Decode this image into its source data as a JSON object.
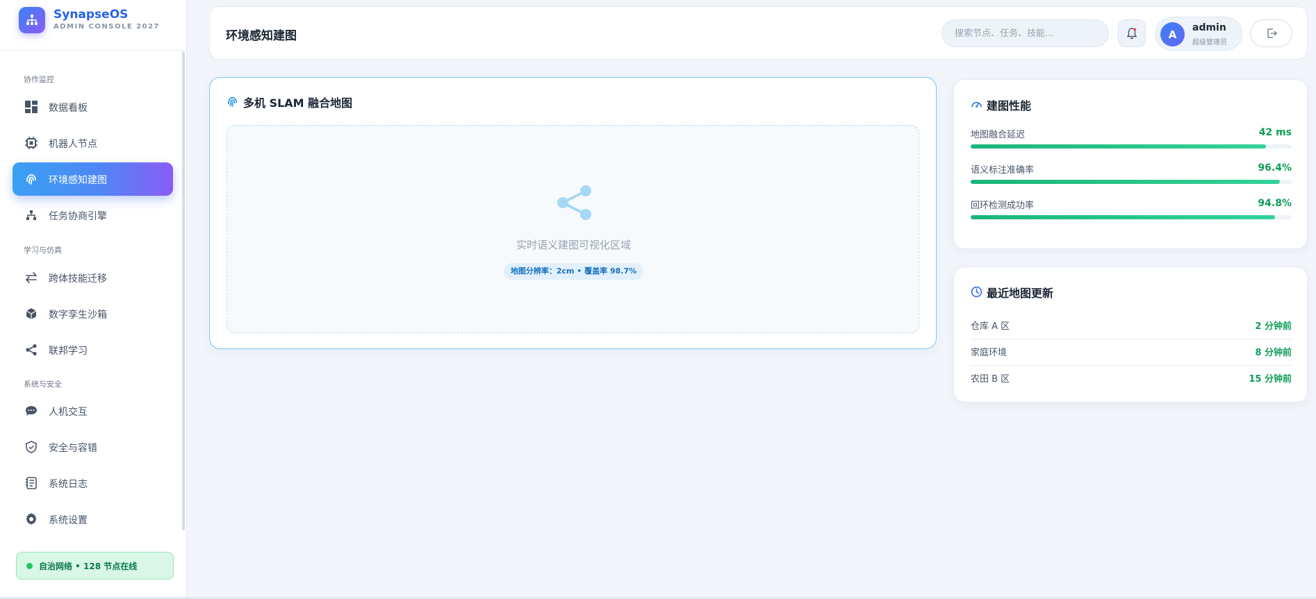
{
  "brand": {
    "name": "SynapseOS",
    "subtitle": "ADMIN CONSOLE 2027"
  },
  "sidebar": {
    "sections": [
      {
        "label": "协作监控"
      },
      {
        "label": "学习与仿真"
      },
      {
        "label": "系统与安全"
      }
    ],
    "items": [
      {
        "label": "数据看板",
        "icon": "dashboard-icon"
      },
      {
        "label": "机器人节点",
        "icon": "chip-icon"
      },
      {
        "label": "环境感知建图",
        "icon": "fingerprint-icon",
        "active": true
      },
      {
        "label": "任务协商引擎",
        "icon": "sitemap-icon"
      },
      {
        "label": "跨体技能迁移",
        "icon": "swap-arrows-icon"
      },
      {
        "label": "数字孪生沙箱",
        "icon": "cube-icon"
      },
      {
        "label": "联邦学习",
        "icon": "share-nodes-icon"
      },
      {
        "label": "人机交互",
        "icon": "chat-bubble-icon"
      },
      {
        "label": "安全与容错",
        "icon": "shield-icon"
      },
      {
        "label": "系统日志",
        "icon": "log-book-icon"
      },
      {
        "label": "系统设置",
        "icon": "gear-icon"
      }
    ],
    "network_status": "自治网络 • 128 节点在线"
  },
  "header": {
    "title": "环境感知建图",
    "search_placeholder": "搜索节点、任务、技能...",
    "user": {
      "initial": "A",
      "name": "admin",
      "role": "超级管理员"
    }
  },
  "map_panel": {
    "title": "多机 SLAM 融合地图",
    "caption": "实时语义建图可视化区域",
    "chip": "地图分辨率：2cm • 覆盖率 98.7%"
  },
  "performance": {
    "title": "建图性能",
    "metrics": [
      {
        "label": "地图融合延迟",
        "value": "42 ms",
        "fill": 0.92
      },
      {
        "label": "语义标注准确率",
        "value": "96.4%",
        "fill": 0.964
      },
      {
        "label": "回环检测成功率",
        "value": "94.8%",
        "fill": 0.948
      }
    ]
  },
  "updates": {
    "title": "最近地图更新",
    "rows": [
      {
        "name": "仓库 A 区",
        "time": "2 分钟前"
      },
      {
        "name": "家庭环境",
        "time": "8 分钟前"
      },
      {
        "name": "农田 B 区",
        "time": "15 分钟前"
      }
    ]
  },
  "colors": {
    "accent": "#3b82f6",
    "accent_purple": "#8b5cf6",
    "success": "#0f9d58",
    "status_bg": "#d8f7e6"
  }
}
